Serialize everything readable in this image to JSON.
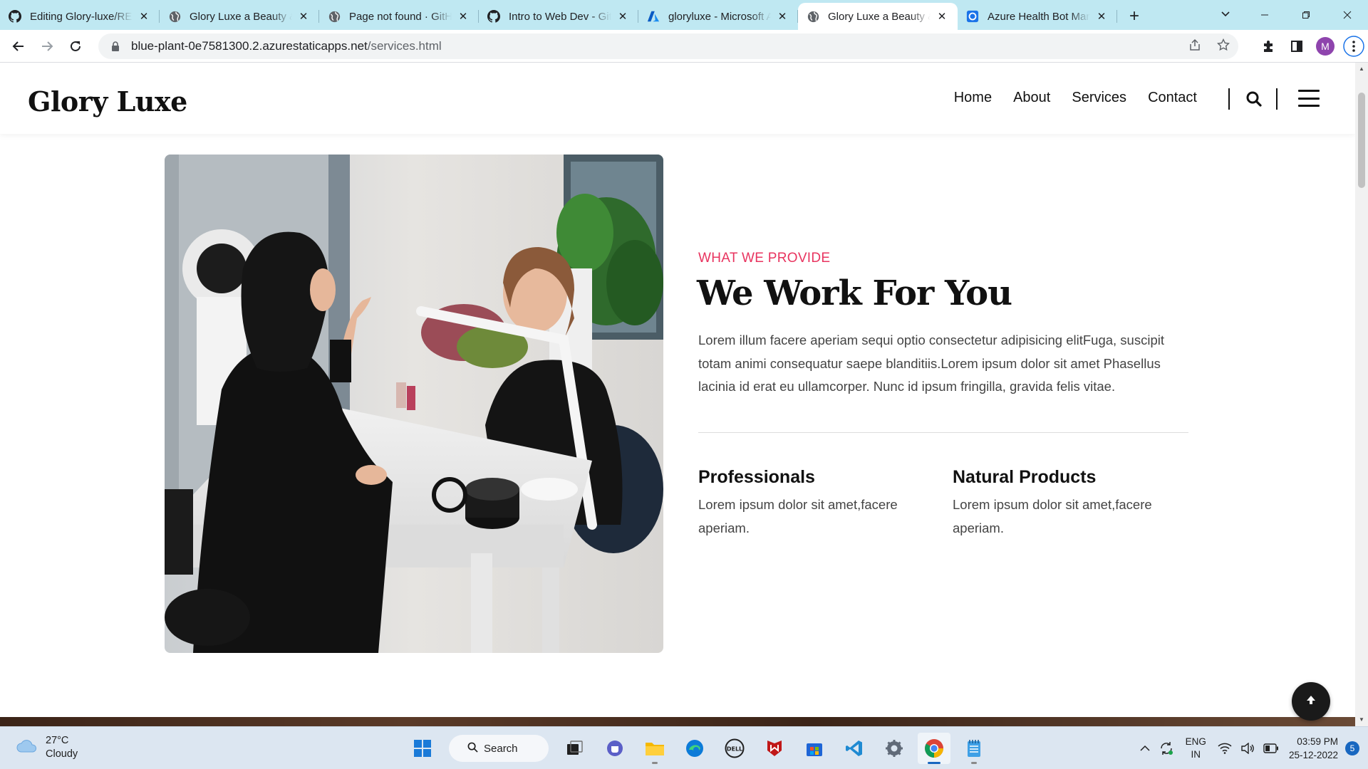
{
  "browser": {
    "tabs": [
      {
        "title": "Editing Glory-luxe/README",
        "icon": "github-icon"
      },
      {
        "title": "Glory Luxe a Beauty & Spa",
        "icon": "globe-icon"
      },
      {
        "title": "Page not found · GitHub",
        "icon": "globe-icon"
      },
      {
        "title": "Intro to Web Dev - GitHub",
        "icon": "github-icon"
      },
      {
        "title": "gloryluxe - Microsoft Azure",
        "icon": "azure-icon"
      },
      {
        "title": "Glory Luxe a Beauty & Spa",
        "icon": "globe-icon",
        "active": true
      },
      {
        "title": "Azure Health Bot Management",
        "icon": "healthbot-icon"
      }
    ],
    "url_host": "blue-plant-0e7581300.2.azurestaticapps.net",
    "url_path": "/services.html",
    "profile_initial": "M",
    "profile_color": "#8e44ad"
  },
  "site": {
    "logo": "Glory Luxe",
    "nav": [
      "Home",
      "About",
      "Services",
      "Contact"
    ],
    "accent": "#e8345f",
    "section": {
      "eyebrow": "WHAT WE PROVIDE",
      "title": "We Work For You",
      "lead": "Lorem illum facere aperiam sequi optio consectetur adipisicing elitFuga, suscipit totam animi consequatur saepe blanditiis.Lorem ipsum dolor sit amet Phasellus lacinia id erat eu ullamcorper. Nunc id ipsum fringilla, gravida felis vitae.",
      "features": [
        {
          "title": "Professionals",
          "text": "Lorem ipsum dolor sit amet,facere aperiam."
        },
        {
          "title": "Natural Products",
          "text": "Lorem ipsum dolor sit amet,facere aperiam."
        }
      ]
    }
  },
  "taskbar": {
    "weather_temp": "27°C",
    "weather_desc": "Cloudy",
    "search_label": "Search",
    "lang_top": "ENG",
    "lang_bottom": "IN",
    "time": "03:59 PM",
    "date": "25-12-2022",
    "notification_count": "5"
  }
}
